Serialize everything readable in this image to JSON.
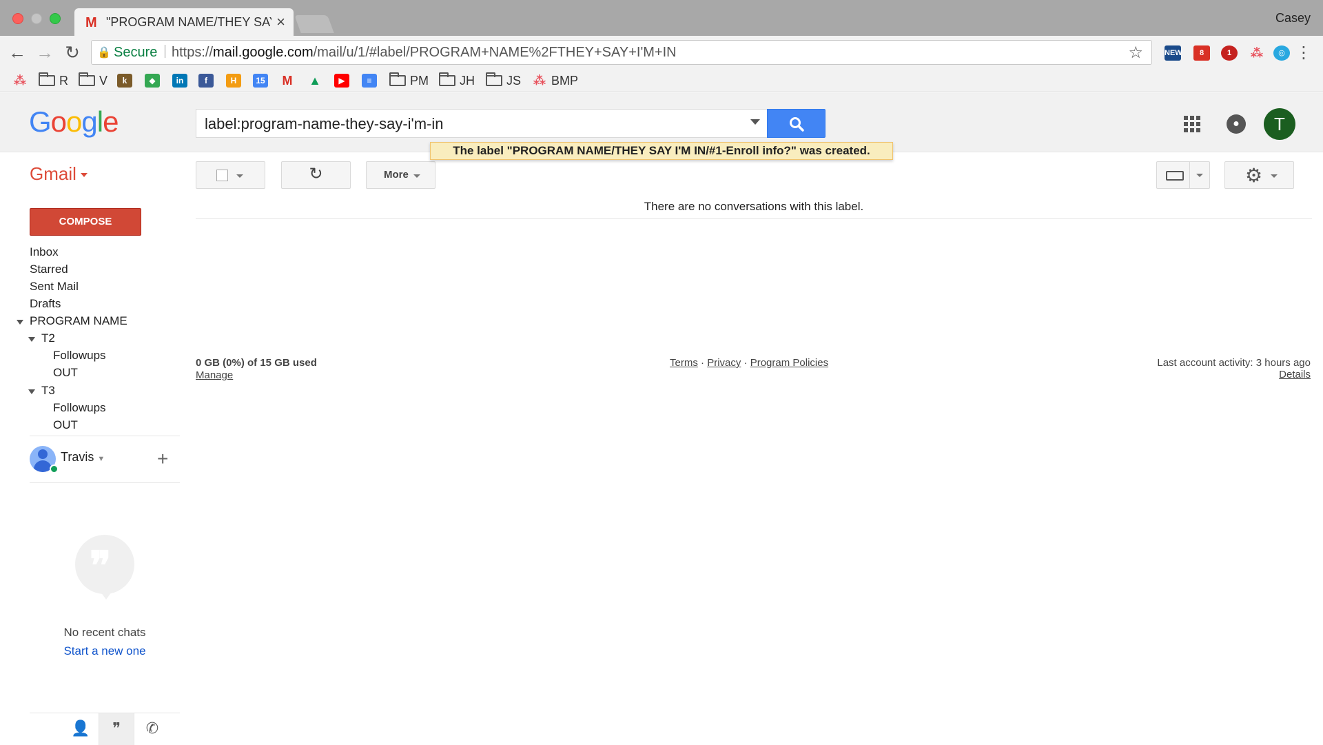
{
  "browser": {
    "tab_title": "\"PROGRAM NAME/THEY SAY I",
    "tab_favicon": "M",
    "tab_close": "×",
    "profile_name": "Casey",
    "secure_label": "Secure",
    "url_scheme": "https://",
    "url_host": "mail.google.com",
    "url_path": "/mail/u/1/#label/PROGRAM+NAME%2FTHEY+SAY+I'M+IN",
    "bookmarks": [
      {
        "label": "R"
      },
      {
        "label": "V"
      },
      {
        "label": "PM"
      },
      {
        "label": "JH"
      },
      {
        "label": "JS"
      },
      {
        "label": "BMP"
      }
    ],
    "extension_badges": [
      "NEW",
      "8",
      "1"
    ]
  },
  "header": {
    "logo": "Google",
    "search_value": "label:program-name-they-say-i'm-in",
    "avatar_letter": "T"
  },
  "toolbar": {
    "gmail_label": "Gmail",
    "more_label": "More",
    "refresh_glyph": "↻"
  },
  "toast": "The label \"PROGRAM NAME/THEY SAY I'M IN/#1-Enroll info?\" was created.",
  "sidebar": {
    "compose_label": "COMPOSE",
    "items": [
      {
        "label": "Inbox"
      },
      {
        "label": "Starred"
      },
      {
        "label": "Sent Mail"
      },
      {
        "label": "Drafts"
      },
      {
        "label": "PROGRAM NAME"
      },
      {
        "label": "T2"
      },
      {
        "label": "Followups"
      },
      {
        "label": "OUT"
      },
      {
        "label": "T3"
      },
      {
        "label": "Followups"
      },
      {
        "label": "OUT"
      }
    ],
    "user_name": "Travis",
    "no_chats": "No recent chats",
    "start_chat": "Start a new one"
  },
  "main": {
    "empty_message": "There are no conversations with this label.",
    "storage": "0 GB (0%) of 15 GB used",
    "manage": "Manage",
    "footer_terms": "Terms",
    "footer_privacy": "Privacy",
    "footer_policies": "Program Policies",
    "footer_sep": "·",
    "activity": "Last account activity: 3 hours ago",
    "details": "Details"
  },
  "colors": {
    "compose": "#d14836",
    "search_button": "#4285f4",
    "gmail_red": "#dd4b39",
    "toast_bg": "#f9edbe",
    "avatar": "#1b5e20"
  }
}
